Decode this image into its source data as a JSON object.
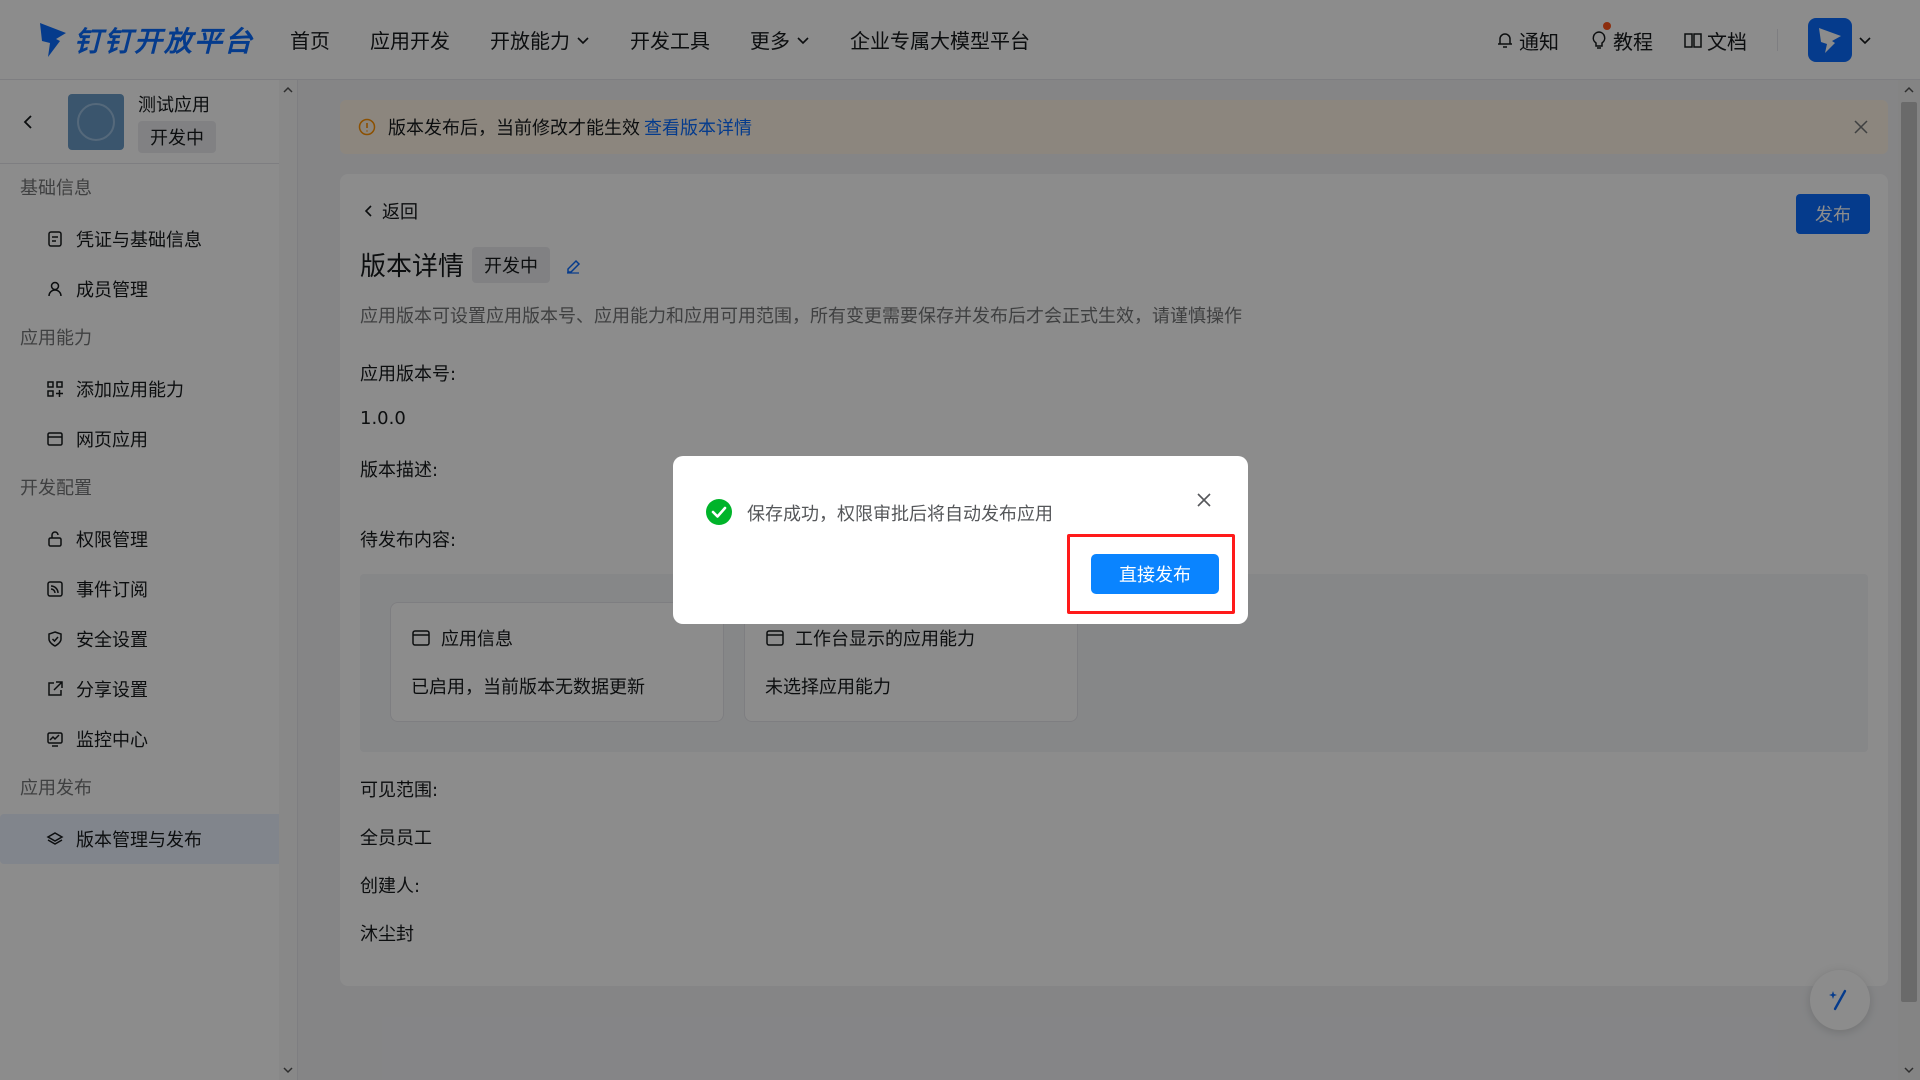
{
  "header": {
    "logo_text": "钉钉开放平台",
    "nav": [
      {
        "label": "首页",
        "has_dropdown": false
      },
      {
        "label": "应用开发",
        "has_dropdown": false
      },
      {
        "label": "开放能力",
        "has_dropdown": true
      },
      {
        "label": "开发工具",
        "has_dropdown": false
      },
      {
        "label": "更多",
        "has_dropdown": true
      },
      {
        "label": "企业专属大模型平台",
        "has_dropdown": false
      }
    ],
    "notify_label": "通知",
    "tutorial_label": "教程",
    "docs_label": "文档"
  },
  "sidebar": {
    "app_name": "测试应用",
    "app_status": "开发中",
    "groups": [
      {
        "title": "基础信息",
        "items": [
          {
            "label": "凭证与基础信息",
            "icon": "credential-icon"
          },
          {
            "label": "成员管理",
            "icon": "user-icon"
          }
        ]
      },
      {
        "title": "应用能力",
        "items": [
          {
            "label": "添加应用能力",
            "icon": "grid-add-icon"
          },
          {
            "label": "网页应用",
            "icon": "window-icon"
          }
        ]
      },
      {
        "title": "开发配置",
        "items": [
          {
            "label": "权限管理",
            "icon": "lock-icon"
          },
          {
            "label": "事件订阅",
            "icon": "rss-icon"
          },
          {
            "label": "安全设置",
            "icon": "shield-icon"
          },
          {
            "label": "分享设置",
            "icon": "share-icon"
          },
          {
            "label": "监控中心",
            "icon": "monitor-icon"
          }
        ]
      },
      {
        "title": "应用发布",
        "items": [
          {
            "label": "版本管理与发布",
            "icon": "layers-icon",
            "active": true
          }
        ]
      }
    ]
  },
  "banner": {
    "text": "版本发布后，当前修改才能生效",
    "link": "查看版本详情"
  },
  "detail": {
    "back_label": "返回",
    "publish_label": "发布",
    "title": "版本详情",
    "status": "开发中",
    "description": "应用版本可设置应用版本号、应用能力和应用可用范围，所有变更需要保存并发布后才会正式生效，请谨慎操作",
    "version_label": "应用版本号:",
    "version_value": "1.0.0",
    "version_desc_label": "版本描述:",
    "pending_label": "待发布内容:",
    "pending_cards": [
      {
        "title": "应用信息",
        "body": "已启用，当前版本无数据更新"
      },
      {
        "title": "工作台显示的应用能力",
        "body": "未选择应用能力"
      }
    ],
    "visibility_label": "可见范围:",
    "visibility_value": "全员员工",
    "creator_label": "创建人:",
    "creator_value": "沐尘封"
  },
  "modal": {
    "message": "保存成功，权限审批后将自动发布应用",
    "button_label": "直接发布"
  },
  "colors": {
    "primary": "#0a6cff",
    "modal_button": "#0a84ff",
    "success": "#00b42a",
    "highlight": "#ff1a1a",
    "banner_bg": "#fff5e6"
  }
}
